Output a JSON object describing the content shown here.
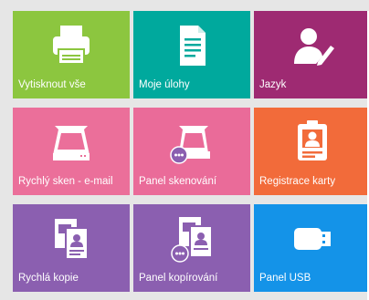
{
  "tiles": [
    {
      "label": "Vytisknout vše",
      "color": "#8cc63f",
      "icon": "printer-icon"
    },
    {
      "label": "Moje úlohy",
      "color": "#00a99d",
      "icon": "document-icon"
    },
    {
      "label": "Jazyk",
      "color": "#9e2a72",
      "icon": "user-edit-icon"
    },
    {
      "label": "Rychlý sken - e-mail",
      "color": "#eb6f9a",
      "icon": "scanner-icon"
    },
    {
      "label": "Panel skenování",
      "color": "#ea6b99",
      "icon": "scanner-panel-icon"
    },
    {
      "label": "Registrace karty",
      "color": "#f26b3a",
      "icon": "id-card-icon"
    },
    {
      "label": "Rychlá kopie",
      "color": "#8b5fb0",
      "icon": "copy-icon"
    },
    {
      "label": "Panel kopírování",
      "color": "#8b5fb0",
      "icon": "copy-panel-icon"
    },
    {
      "label": "Panel USB",
      "color": "#1493e8",
      "icon": "usb-icon"
    }
  ]
}
